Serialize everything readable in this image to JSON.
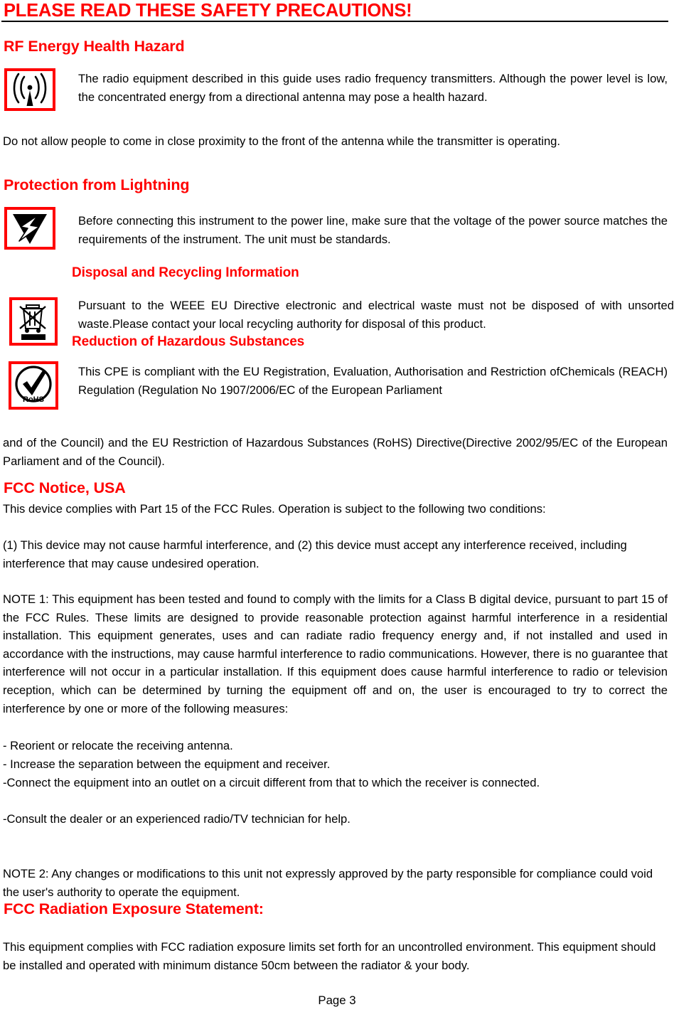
{
  "document": {
    "title": "PLEASE READ THESE SAFETY PRECAUTIONS!",
    "page_number": "Page 3",
    "accent_color": "#FF0000",
    "text_color": "#000000",
    "background_color": "#FFFFFF"
  },
  "sections": {
    "rf": {
      "heading": "RF Energy Health Hazard",
      "icon": "rf-antenna-radiation-icon",
      "icon_paragraph": "The radio equipment described in this guide uses radio frequency transmitters. Although the power level is low, the concentrated energy from a directional antenna may pose a health hazard.",
      "followup_paragraph": "Do not allow people to come in close proximity to the front of the antenna while the transmitter is operating."
    },
    "lightning": {
      "heading": "Protection from Lightning",
      "icon": "lightning-hazard-icon",
      "icon_paragraph": "Before connecting this instrument to the power line, make sure that the voltage of the power source matches the requirements of the instrument. The unit must be standards."
    },
    "disposal": {
      "heading": "Disposal and Recycling Information",
      "icon": "weee-crossed-out-wheelie-bin-icon",
      "icon_paragraph": "Pursuant to the WEEE EU Directive electronic and electrical waste must not be disposed of with unsorted waste.Please contact your local recycling authority for disposal of this product."
    },
    "rohs": {
      "heading": "Reduction of Hazardous Substances",
      "icon": "rohs-compliance-icon",
      "icon_paragraph": "This CPE is compliant with the EU Registration, Evaluation, Authorisation and Restriction ofChemicals (REACH) Regulation (Regulation No 1907/2006/EC of the European Parliament",
      "icon_label": "RoHS",
      "followup_paragraph": "and of the Council) and the EU Restriction of Hazardous Substances (RoHS) Directive(Directive 2002/95/EC of the European Parliament and of the Council)."
    },
    "fcc": {
      "heading": "FCC Notice, USA",
      "paragraph_1": "This device complies with Part 15 of the FCC Rules. Operation is subject to the following two conditions:",
      "paragraph_2": "(1) This device may not cause harmful interference, and (2) this device must accept any interference received, including interference that may cause undesired operation.",
      "note_1": "NOTE 1: This equipment has been tested and found to comply with the limits for a Class B digital device, pursuant to part 15 of the FCC Rules. These limits are designed to provide reasonable protection against harmful interference in a residential installation. This equipment generates, uses and can radiate radio frequency energy and, if not installed and used in accordance with the instructions, may cause harmful interference to radio communications. However, there is no guarantee that interference will not occur in a particular installation. If this equipment does cause harmful interference to radio or television reception, which can be determined by turning the equipment off and on, the user is encouraged to try to correct the interference by one or more of the following measures:",
      "measures": [
        "- Reorient or relocate the receiving antenna.",
        "- Increase the separation between the equipment and receiver.",
        "-Connect the equipment into an outlet on a circuit different from that to which the receiver is connected.",
        "-Consult the dealer or an experienced radio/TV technician for help."
      ],
      "note_2": "NOTE 2: Any changes or modifications to this unit not expressly approved by the party responsible for compliance could void the user's authority to operate the equipment."
    },
    "radiation": {
      "heading": "FCC Radiation Exposure Statement:",
      "paragraph": "This equipment complies with FCC radiation exposure limits set forth for an uncontrolled environment. This equipment should be installed and operated with minimum distance 50cm between the radiator & your body."
    }
  }
}
